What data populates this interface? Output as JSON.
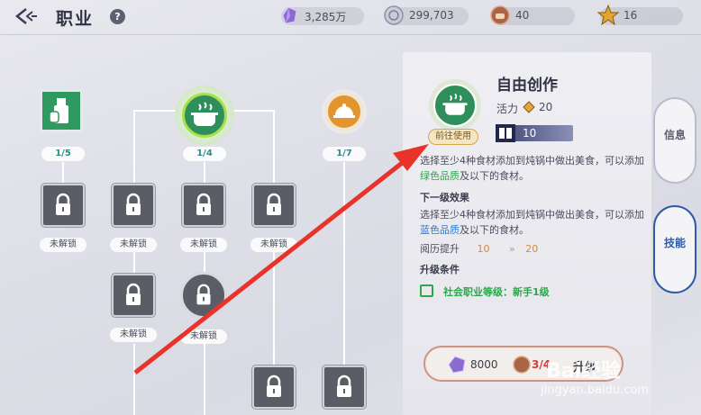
{
  "header": {
    "title": "职业",
    "help": "?",
    "resources": [
      {
        "name": "purple-crystal-icon",
        "value": "3,285万"
      },
      {
        "name": "silver-coin-icon",
        "value": "299,703"
      },
      {
        "name": "pot-token-icon",
        "value": "40"
      },
      {
        "name": "gold-star-icon",
        "value": "16"
      }
    ]
  },
  "tree": {
    "columns": [
      {
        "count": "1/5"
      },
      {
        "count": "1/4"
      },
      {
        "count": "1/7"
      }
    ],
    "locked_label": "未解锁"
  },
  "skill": {
    "name": "自由创作",
    "vitality_label": "活力",
    "vitality_value": "20",
    "exp_value": "10",
    "goto_label": "前往使用",
    "desc1": "选择至少4种食材添加到炖锅中做出美食，可以添加",
    "desc1_hl": "绿色品质",
    "desc1_tail": "及以下的食材。",
    "next_title": "下一级效果",
    "desc2": "选择至少4种食材添加到炖锅中做出美食，可以添加",
    "desc2_hl": "蓝色品质",
    "desc2_tail": "及以下的食材。",
    "upgrade_label": "阅历提升",
    "upgrade_from": "10",
    "upgrade_to": "20",
    "cond_title": "升级条件",
    "cond_text": "社会职业等级：新手1级",
    "cost1": "8000",
    "cost2": "3/4",
    "upgrade_btn": "升级"
  },
  "tabs": {
    "info": "信息",
    "skill": "技能"
  },
  "watermark": {
    "brand": "Bai经验",
    "url": "jingyan.baidu.com"
  },
  "colors": {
    "accent_green": "#2aa84a",
    "accent_blue": "#2a7ad8",
    "arrow_red": "#e8332a"
  }
}
